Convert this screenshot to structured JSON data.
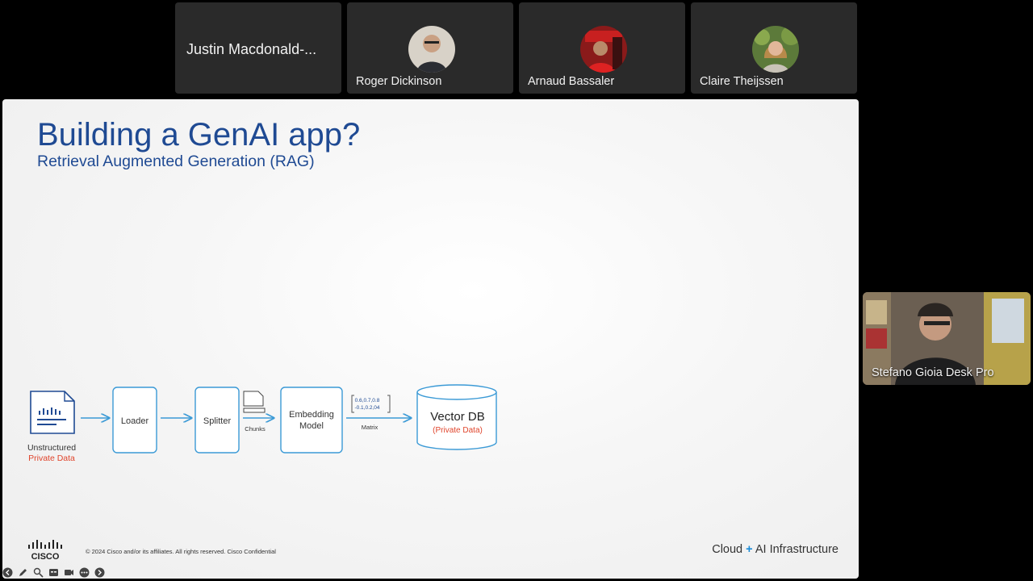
{
  "participants": [
    {
      "name": "Justin Macdonald-...",
      "has_video": false
    },
    {
      "name": "Roger Dickinson",
      "has_video": true
    },
    {
      "name": "Arnaud Bassaler",
      "has_video": true
    },
    {
      "name": "Claire Theijssen",
      "has_video": true
    }
  ],
  "slide": {
    "title": "Building a GenAI app?",
    "subtitle": "Retrieval Augmented Generation (RAG)",
    "diagram": {
      "source_label": "Unstructured",
      "source_sublabel": "Private Data",
      "loader": "Loader",
      "splitter": "Splitter",
      "chunks": "Chunks",
      "embedding_line1": "Embedding",
      "embedding_line2": "Model",
      "matrix_row1": "0.6,0.7,0.8",
      "matrix_row2": "-0.1,0.2,04",
      "matrix": "Matrix",
      "vectordb": "Vector DB",
      "vectordb_sub": "(Private Data)"
    },
    "footer_copyright": "© 2024  Cisco and/or its affiliates. All rights reserved.   Cisco Confidential",
    "footer_brand_cloud": "Cloud",
    "footer_brand_plus": "+",
    "footer_brand_rest": "AI Infrastructure",
    "logo_text": "CISCO"
  },
  "self_view": {
    "name": "Stefano Gioia Desk Pro"
  },
  "colors": {
    "title_blue": "#1f4a93",
    "diagram_blue": "#3b9ad6",
    "accent_red": "#e0452c"
  },
  "toolbar_icons": [
    "back-icon",
    "pen-icon",
    "zoom-icon",
    "captions-icon",
    "camera-icon",
    "more-icon",
    "next-icon"
  ]
}
